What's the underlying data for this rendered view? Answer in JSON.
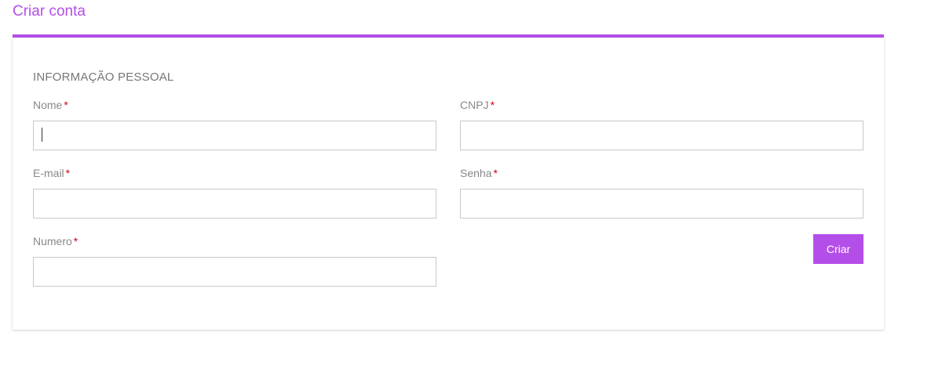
{
  "page": {
    "title": "Criar conta"
  },
  "form": {
    "section_title": "INFORMAÇÃO PESSOAL",
    "required_marker": "*",
    "fields": {
      "nome": {
        "label": "Nome",
        "value": "",
        "placeholder": ""
      },
      "cnpj": {
        "label": "CNPJ",
        "value": "",
        "placeholder": ""
      },
      "email": {
        "label": "E-mail",
        "value": "",
        "placeholder": ""
      },
      "senha": {
        "label": "Senha",
        "value": "",
        "placeholder": ""
      },
      "numero": {
        "label": "Numero",
        "value": "",
        "placeholder": ""
      }
    },
    "submit_label": "Criar"
  },
  "colors": {
    "accent": "#b44ee8",
    "required": "#d0021b",
    "input_border": "#c9c9c9",
    "label": "#888888"
  }
}
